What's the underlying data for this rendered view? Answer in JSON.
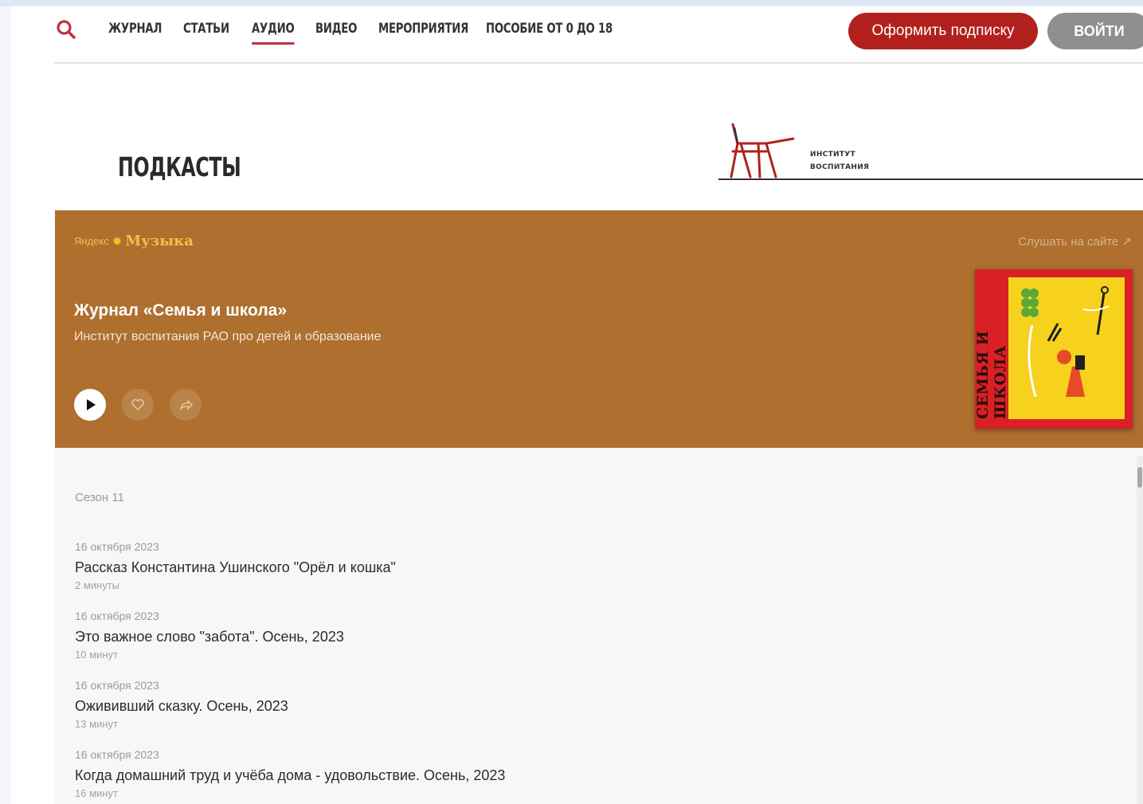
{
  "nav": {
    "search_icon": "search-icon",
    "links": [
      "ЖУРНАЛ",
      "СТАТЬИ",
      "АУДИО",
      "ВИДЕО",
      "МЕРОПРИЯТИЯ",
      "ПОСОБИЕ ОТ 0 ДО 18"
    ],
    "active_link": "АУДИО",
    "subscribe_label": "Оформить подписку",
    "login_label": "ВОЙТИ"
  },
  "page": {
    "title": "ПОДКАСТЫ"
  },
  "institute_logo": {
    "line1": "ИНСТИТУТ",
    "line2": "ВОСПИТАНИЯ"
  },
  "player": {
    "brand_small": "Яндекс",
    "brand_music": "Музыка",
    "listen_label": "Слушать на сайте ↗",
    "title": "Журнал «Семья и школа»",
    "subtitle": "Институт воспитания РАО про детей и образование",
    "cover_text": "СЕМЬЯ И ШКОЛА",
    "colors": {
      "background": "#ae6f2f",
      "cover_red": "#d92027",
      "cover_yellow": "#f6d21c"
    }
  },
  "episodes": {
    "season": "Сезон 11",
    "items": [
      {
        "date": "16 октября 2023",
        "title": "Рассказ Константина Ушинского \"Орёл и кошка\"",
        "duration": "2 минуты"
      },
      {
        "date": "16 октября 2023",
        "title": "Это важное слово \"забота\". Осень, 2023",
        "duration": "10 минут"
      },
      {
        "date": "16 октября 2023",
        "title": "Ожививший сказку. Осень, 2023",
        "duration": "13 минут"
      },
      {
        "date": "16 октября 2023",
        "title": "Когда домашний труд и учёба дома - удовольствие. Осень, 2023",
        "duration": "16 минут"
      }
    ]
  },
  "accent_color": "#b2201d"
}
